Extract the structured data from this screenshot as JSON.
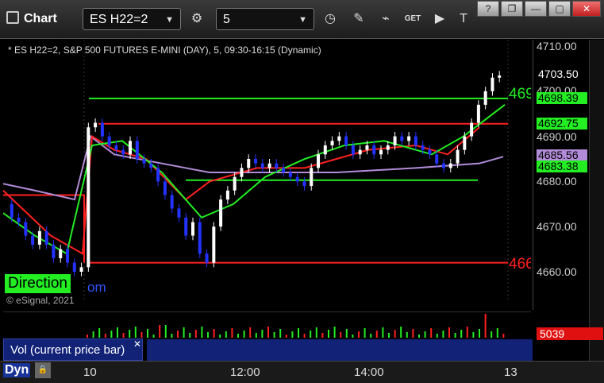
{
  "header": {
    "app_title": "Chart",
    "symbol_value": "ES H22=2",
    "interval_value": "5",
    "get_label": "GET"
  },
  "window_buttons": [
    "?",
    "❐",
    "—",
    "▢",
    "✕"
  ],
  "chart": {
    "info_line": "* ES H22=2, S&P 500 FUTURES E-MINI (DAY), 5, 09:30-16:15 (Dynamic)",
    "y_ticks": [
      "4710.00",
      "4700.00",
      "4690.00",
      "4680.00",
      "4670.00",
      "4660.00"
    ],
    "price_tags": [
      {
        "value": "4703.50",
        "bg": "#000000",
        "fg": "#ffffff"
      },
      {
        "value": "4698.39",
        "bg": "#22ee22",
        "fg": "#000000"
      },
      {
        "value": "4692.75",
        "bg": "#22ee22",
        "fg": "#000000"
      },
      {
        "value": "4685.56",
        "bg": "#b28cd8",
        "fg": "#000000"
      },
      {
        "value": "4683.38",
        "bg": "#22ee22",
        "fg": "#000000"
      }
    ],
    "line_labels": [
      "469",
      "466"
    ],
    "direction_label": "Direction",
    "direction_suffix": "om",
    "watermark": "© eSignal, 2021",
    "x_ticks": [
      "10",
      "12:00",
      "14:00",
      "13"
    ]
  },
  "volume": {
    "label": "Vol (current price bar)",
    "close": "✕",
    "value": "5039",
    "tag_color": "#e01010"
  },
  "footer": {
    "dyn_label": "Dyn",
    "dyn_icon": "lock-icon"
  },
  "colors": {
    "up_candle": "#ffffff",
    "down_candle": "#2233ff",
    "red_line": "#ff2020",
    "green_line": "#22ee22",
    "purple_line": "#b28cd8"
  }
}
